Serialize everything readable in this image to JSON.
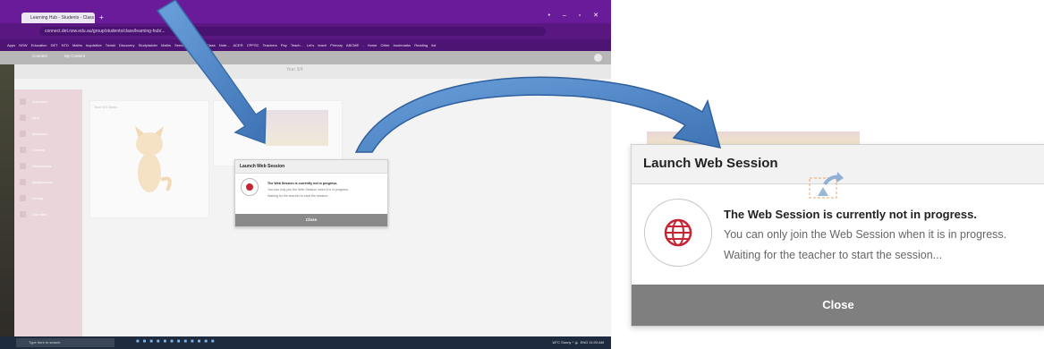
{
  "browser": {
    "tab_title": "Learning Hub - Students - Class ...",
    "tab_new": "+",
    "window_controls": "• – ▫ ✕",
    "url": "connect.det.nsw.edu.au/group/students/class/learning-hub/...",
    "bookmarks": "Apps  NSW Education  DET  NTD Maths  Inquisitive  Twinkl  Discovery  Studyladder  Maths Seeds  OneNote Class Note...  ACER  CPPSC  Teachers Pay Teach...  Let's teach Primary  ABCME - Home  Other bookmarks  Reading list"
  },
  "app": {
    "nav_items": [
      "Connect",
      "My Content"
    ],
    "site_title": "Year 3/4",
    "sidebar_items": [
      "Overview",
      "Kind",
      "Members",
      "Content",
      "Discussions",
      "Assignments",
      "Library",
      "Live Web"
    ],
    "card_title": "Year 3/4 News"
  },
  "mini_dialog": {
    "title": "Launch Web Session",
    "line1": "The Web Session is currently not in progress.",
    "line2": "You can only join the Web Session when it is in progress.",
    "line3": "Waiting for the teacher to start the session...",
    "close": "Close"
  },
  "taskbar": {
    "search_placeholder": "Type here to search",
    "status": "18°C Sunny  ^ 🔈 ENG  11:03 AM"
  },
  "dialog": {
    "title": "Launch Web Session",
    "message_bold": "The Web Session is currently not in progress.",
    "message_line2": "You can only join the Web Session when it is in progress.",
    "message_line3": "Waiting for the teacher to start the session...",
    "close_label": "Close"
  },
  "colors": {
    "browser_chrome": "#6a1b9a",
    "close_bar": "#7f7f7f",
    "globe_red": "#c82333",
    "arrow_blue": "#4a84c7"
  },
  "icons": [
    "globe-icon",
    "arrow-annotation",
    "curved-arrow-annotation",
    "share-icon"
  ]
}
